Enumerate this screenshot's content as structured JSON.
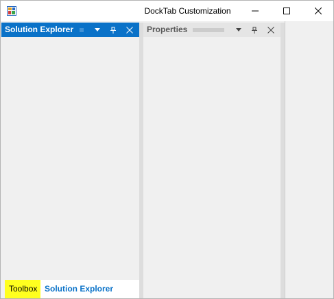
{
  "window": {
    "title": "DockTab Customization",
    "icon": "app-icon"
  },
  "caption_buttons": {
    "minimize": "minimize-icon",
    "maximize": "maximize-icon",
    "close": "close-icon"
  },
  "panels": {
    "solution_explorer": {
      "caption": "Solution Explorer",
      "header_color": "#0a72c8",
      "active": true
    },
    "properties": {
      "caption": "Properties",
      "header_color": "#e5e5e5",
      "active": false
    }
  },
  "tabs": [
    {
      "label": "Toolbox",
      "background": "#ffff1f",
      "text_color": "#000000"
    },
    {
      "label": "Solution Explorer",
      "background": "#ffffff",
      "text_color": "#0a72c8"
    }
  ]
}
